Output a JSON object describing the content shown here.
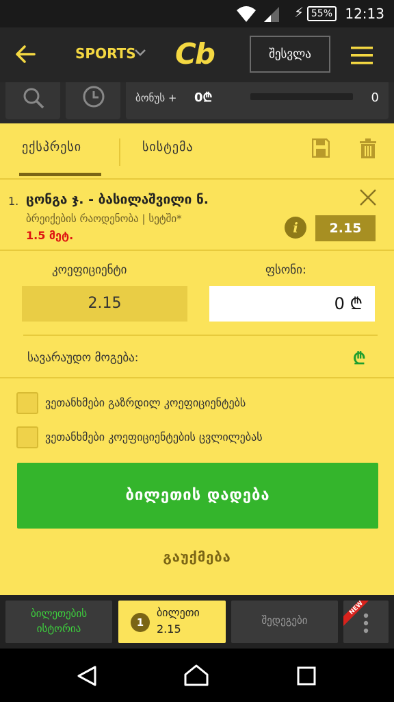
{
  "status": {
    "battery": "55%",
    "time": "12:13"
  },
  "header": {
    "sports_label": "SPORTS",
    "logo": "Cb",
    "login_label": "შესვლა"
  },
  "search_row": {
    "bonus_label": "ბონუს +",
    "bonus_value": "0₾",
    "count": "0"
  },
  "tabs": {
    "express": "ექსპრესი",
    "system": "სისტემა"
  },
  "bet": {
    "number": "1.",
    "title": "ცონგა ჯ. - ბასილაშვილი ნ.",
    "market": "ბრეიქების რაოდენობა | სეტში*",
    "selection": "1.5 მეტ.",
    "odds": "2.15"
  },
  "stake_area": {
    "coef_label": "კოეფიციენტი",
    "stake_label": "ფსონი:",
    "coef_value": "2.15",
    "stake_value": "0 ₾",
    "possible_win_label": "სავარაუდო მოგება:",
    "possible_win_currency": "₾"
  },
  "options": {
    "accept_higher": "ვეთანხმები გაზრდილ კოეფიციენტებს",
    "accept_changes": "ვეთანხმები კოეფიციენტების ცვლილებას"
  },
  "actions": {
    "place_bet": "ბილეთის დადება",
    "cancel": "გაუქმება"
  },
  "bottom_tabs": {
    "history_line1": "ბილეთების",
    "history_line2": "ისტორია",
    "ticket_count": "1",
    "ticket_label": "ბილეთი",
    "ticket_odds": "2.15",
    "results": "შედეგები",
    "new_badge": "NEW"
  },
  "colors": {
    "accent_yellow": "#fbe35a",
    "brand_yellow": "#f4d842",
    "green": "#34b52c",
    "dark": "#262626"
  }
}
